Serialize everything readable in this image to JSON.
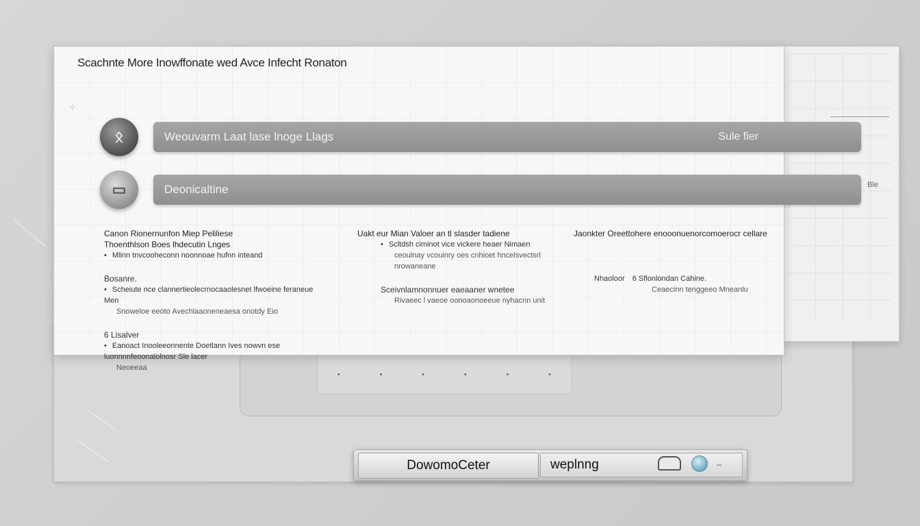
{
  "window": {
    "title": "Scachnte More Inowffonate wed Avce Infecht Ronaton"
  },
  "rows": [
    {
      "label": "Weouvarm Laat lase lnoge Llags",
      "right_label": "Sule fier"
    },
    {
      "label": "Deonicaltine",
      "right_label": ""
    }
  ],
  "columns": {
    "left": {
      "heading1": "Canon Rionernunfon Miep Peliliese",
      "heading2": "Thoenthlson Boes lhdecutin Lnges",
      "item1": "Mlinn tnvcooheconn noonnoae hufnn inteand",
      "section2": "Bosanre.",
      "item2": "Scheiute nce clannertieolecrnocaaolesnet lfwoeine feraneue Men",
      "item2_sub": "Snoweloe eeoto Avechlaaoneneaesa onotdy Eio",
      "section3": "6 Lisalver",
      "item3": "Eanoact Inooleeonnente Doetlann Ives nowvn ese luonnnnfeoonalolnosr Sle lacer",
      "item3_sub": "Neoeeaa"
    },
    "middle": {
      "heading1": "Uakt eur Mian Valoer an tl slasder tadiene",
      "item1": "Scltdsh ciminot vice vickere heaer Nimaen",
      "item1_sub": "ceoulnay vcouinry oes cnhioet hncelsvectsrl nrowaneane",
      "section2": "Sceivnlamnonnuer eaeaaner wnetee",
      "section2_sub": "Rivaeec l vaeoe oonoaonoeeue nyhacnn unit"
    },
    "right": {
      "heading1": "Jaonkter Oreettohere enooonuenorcomoerocr cellare",
      "item1": "Nhaoloor",
      "item1_b": "6 Sflonlondan Cahine.",
      "item1_sub": "Ceaecinn tenggeeo Mneanlu"
    }
  },
  "back_window": {
    "label": "Ble"
  },
  "bottom_bar": {
    "primary_button": "DowomoCeter",
    "field_value": "weplnng"
  },
  "icons": {
    "row1_avatar": "people-icon",
    "row2_avatar": "window-icon",
    "cloud": "cloud-icon",
    "toggle": "toggle-icon"
  }
}
